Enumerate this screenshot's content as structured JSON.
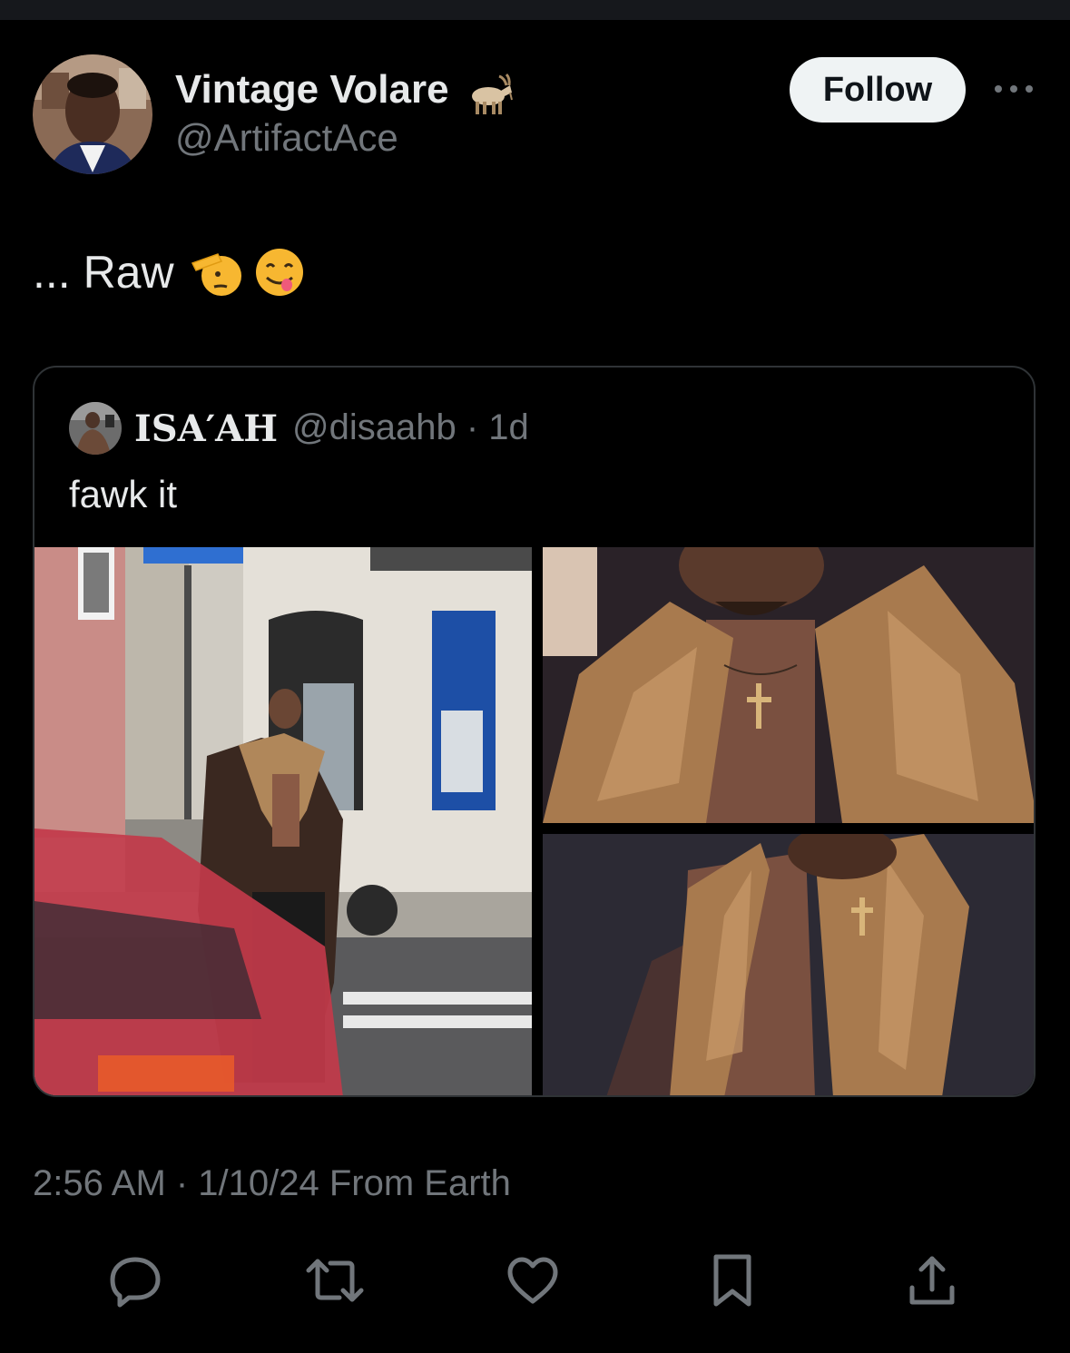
{
  "author": {
    "name": "Vintage Volare",
    "handle": "@ArtifactAce",
    "name_emoji": "goat-emoji"
  },
  "follow_label": "Follow",
  "tweet": {
    "text": "... Raw",
    "emojis": [
      "saluting-face-emoji",
      "face-savoring-food-emoji"
    ]
  },
  "quoted": {
    "name": "ISA′AH",
    "handle": "@disaahb",
    "meta": "@disaahb · 1d",
    "text": "fawk it",
    "media": [
      "street-photo-fur-coat",
      "closeup-fur-collar-top",
      "closeup-fur-collar-bottom"
    ]
  },
  "timestamp": "2:56 AM · 1/10/24 From Earth",
  "actions": [
    "reply-icon",
    "retweet-icon",
    "like-icon",
    "bookmark-icon",
    "share-icon"
  ],
  "colors": {
    "background": "#000000",
    "text": "#e7e9ea",
    "muted": "#71767b",
    "border": "#2f3336",
    "follow_bg": "#eff3f4"
  }
}
